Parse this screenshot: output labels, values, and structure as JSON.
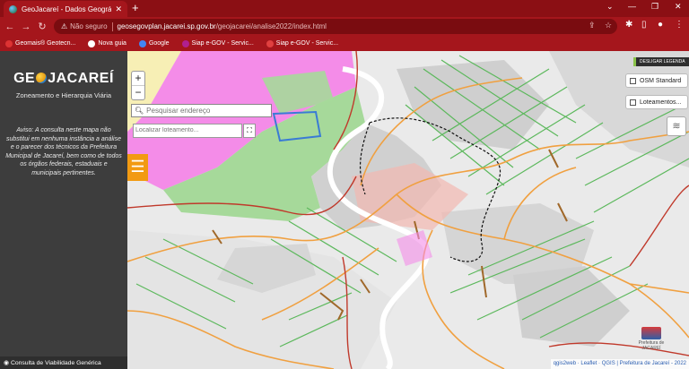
{
  "browser": {
    "tab_title": "GeoJacareí - Dados Geográficos",
    "tab_close": "✕",
    "new_tab": "+",
    "window_controls": [
      "⌄",
      "—",
      "❐",
      "✕"
    ],
    "nav": {
      "back": "←",
      "forward": "→",
      "reload": "↻"
    },
    "url_warning": "Não seguro",
    "url_host": "geosegovplan.jacarei.sp.gov.br",
    "url_path": "/geojacarei/analise2022/index.html",
    "bookmarks": [
      {
        "label": "Geomais® Geotecn...",
        "color": "#d33"
      },
      {
        "label": "Nova guia",
        "color": "#fff"
      },
      {
        "label": "Google",
        "color": "#4285f4"
      },
      {
        "label": "Siap e-GOV - Servic...",
        "color": "#b02090"
      },
      {
        "label": "Siap e-GOV - Servic...",
        "color": "#e04040"
      }
    ]
  },
  "sidebar": {
    "logo_left": "GE",
    "logo_right": "JACAREÍ",
    "subtitle": "Zoneamento e Hierarquia Viária",
    "aviso": "Aviso: A consulta neste mapa não substitui em nenhuma instância a análise e o parecer dos técnicos da Prefeitura Municipal de Jacareí, bem como de todos os órgãos federais, estaduais e municipais pertinentes.",
    "footer": "Consulta de Viabilidade Genérica"
  },
  "map": {
    "zoom_in": "+",
    "zoom_out": "−",
    "search_placeholder": "Pesquisar endereço",
    "loteamento_placeholder": "Localizar loteamento...",
    "menu": "☰",
    "legend_toggle": "DESLIGAR LEGENDA",
    "layers": [
      "OSM Standard",
      "Loteamentos..."
    ],
    "attribution": "qgis2web · Leaflet · QGIS | Prefeitura de Jacareí - 2022",
    "prefeitura_label": "Prefeitura de JACAREÍ",
    "colors": {
      "zone_pink": "#f48ce8",
      "zone_green": "#a6d99a",
      "zone_gray": "#c9c9c9",
      "zone_yellow": "#f7efb5",
      "road_orange": "#f0a040",
      "road_green": "#5cb85c",
      "road_red": "#c0392b",
      "river": "#ffffff"
    }
  }
}
